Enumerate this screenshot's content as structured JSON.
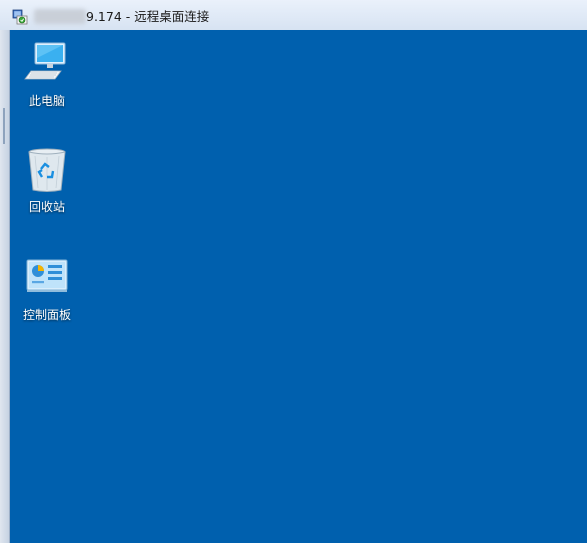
{
  "window": {
    "title": "9.174 - 远程桌面连接"
  },
  "desktop": {
    "background": "#0060ae",
    "icons": [
      {
        "label": "此电脑",
        "icon": "computer-icon"
      },
      {
        "label": "回收站",
        "icon": "recycle-bin-icon"
      },
      {
        "label": "控制面板",
        "icon": "control-panel-icon"
      }
    ]
  }
}
